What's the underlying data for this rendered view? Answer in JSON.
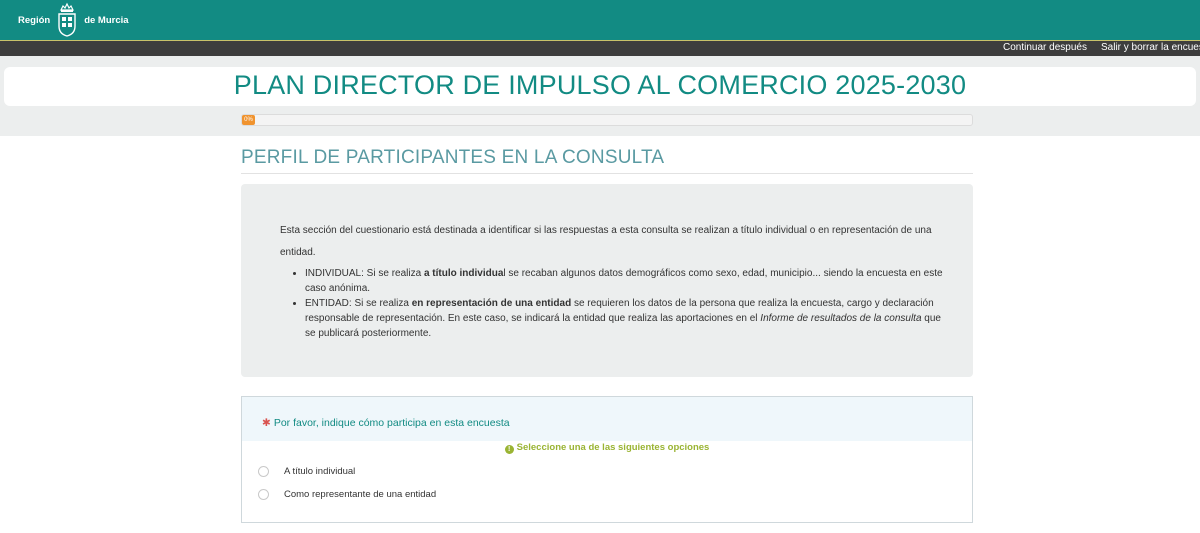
{
  "header": {
    "logo_left": "Región",
    "logo_right": "de Murcia"
  },
  "nav": {
    "continue_label": "Continuar después",
    "exit_label": "Salir y borrar la encuesta"
  },
  "survey": {
    "title": "PLAN DIRECTOR DE IMPULSO AL COMERCIO 2025-2030",
    "progress_label": "0%",
    "progress_fraction": 0.0
  },
  "section": {
    "title": "PERFIL DE PARTICIPANTES EN LA CONSULTA",
    "intro": "Esta sección del cuestionario está destinada a identificar si las respuestas a esta consulta se realizan a título individual o en representación de una entidad.",
    "individual": {
      "prefix": "INDIVIDUAL: Si se realiza ",
      "bold": "a título individua",
      "suffix": "l se recaban algunos datos demográficos como sexo, edad, municipio... siendo la encuesta en este caso anónima."
    },
    "entity": {
      "prefix": "ENTIDAD: Si se realiza ",
      "bold": "en representación de una entidad",
      "middle": " se requieren los datos de la persona que realiza la encuesta, cargo y declaración responsable de representación. En este caso, se indicará la entidad que realiza las aportaciones en el ",
      "italic": "Informe de resultados de la consulta",
      "suffix": " que se publicará posteriormente."
    }
  },
  "question": {
    "asterisk": "✱",
    "text": "Por favor, indique cómo participa en esta encuesta",
    "hint_icon": "!",
    "hint": "Seleccione una de las siguientes opciones",
    "options": [
      {
        "label": "A título individual"
      },
      {
        "label": "Como representante de una entidad"
      }
    ]
  },
  "colors": {
    "brand": "#128b83",
    "progress": "#f0932e",
    "hint": "#9ab433",
    "required": "#d9534f"
  }
}
